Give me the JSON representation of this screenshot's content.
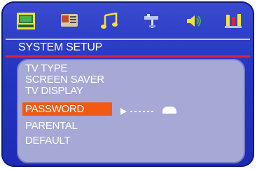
{
  "icon_bar": {
    "icons": [
      "system-setup-icon",
      "language-icon",
      "audio-music-icon",
      "video-antenna-icon",
      "speaker-icon",
      "preference-icon"
    ],
    "active": "system-setup-icon"
  },
  "header": {
    "title": "SYSTEM SETUP"
  },
  "menu": {
    "items": [
      {
        "label": "TV TYPE"
      },
      {
        "label": "SCREEN SAVER"
      },
      {
        "label": "TV DISPLAY"
      },
      {
        "label": "PASSWORD"
      },
      {
        "label": "PARENTAL"
      },
      {
        "label": "DEFAULT"
      }
    ],
    "selected_label": "PASSWORD"
  },
  "colors": {
    "background": "#2436c0",
    "panel": "#a6a8d6",
    "highlight": "#f25a12",
    "title_underline": "#e0213a"
  }
}
